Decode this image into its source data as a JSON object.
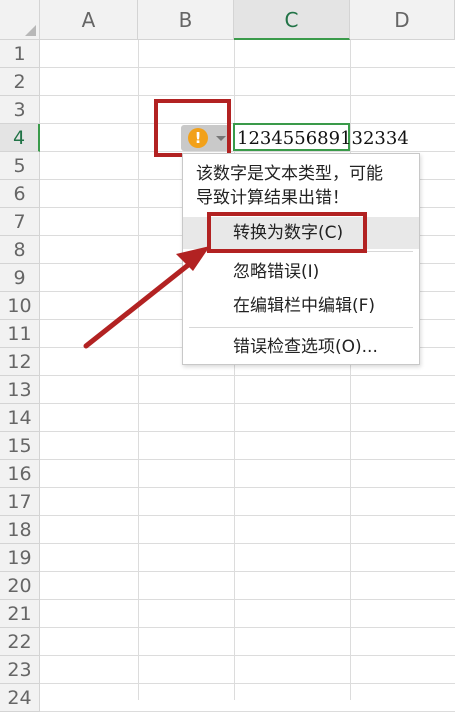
{
  "columns": [
    "A",
    "B",
    "C",
    "D"
  ],
  "rows": [
    "1",
    "2",
    "3",
    "4",
    "5",
    "6",
    "7",
    "8",
    "9",
    "10",
    "11",
    "12",
    "13",
    "14",
    "15",
    "16",
    "17",
    "18",
    "19",
    "20",
    "21",
    "22",
    "23",
    "24"
  ],
  "active_cell": {
    "column": "C",
    "row": "4",
    "value": "123455689132334"
  },
  "error_button": {
    "icon": "warning-icon",
    "icon_glyph": "!",
    "dropdown_icon": "chevron-down-icon"
  },
  "error_menu": {
    "message_line1": "该数字是文本类型，可能",
    "message_line2": "导致计算结果出错！",
    "items": {
      "convert": "转换为数字(C)",
      "ignore": "忽略错误(I)",
      "edit": "在编辑栏中编辑(F)",
      "options": "错误检查选项(O)..."
    }
  },
  "colors": {
    "accent": "#3a9a4a",
    "annotation": "#b22222",
    "warning": "#f2a11a"
  }
}
